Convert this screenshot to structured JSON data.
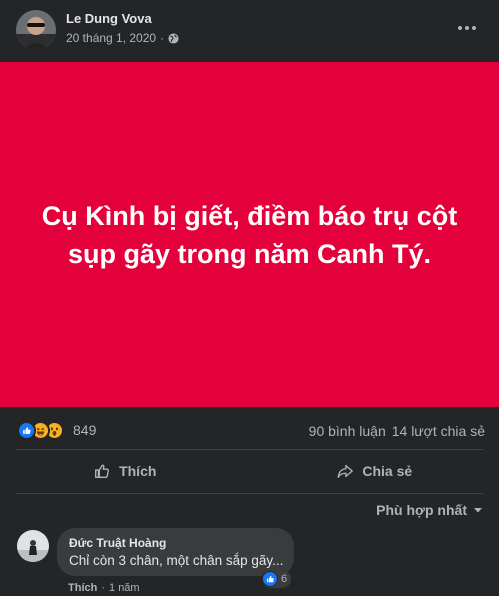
{
  "post": {
    "author_name": "Le Dung Vova",
    "date": "20 tháng 1, 2020",
    "separator": "·",
    "privacy_icon": "globe-icon",
    "more_icon": "more-horizontal-icon",
    "content_text": "Cụ Kình bị giết, điềm báo trụ cột sụp gãy trong năm Canh Tý.",
    "content_background": "#e3003b"
  },
  "stats": {
    "reaction_icons": [
      "like-icon",
      "haha-icon",
      "wow-icon"
    ],
    "reaction_count": "849",
    "comments": "90 bình luận",
    "shares": "14 lượt chia sẻ"
  },
  "actions": {
    "like_label": "Thích",
    "share_label": "Chia sẻ"
  },
  "sort": {
    "label": "Phù hợp nhất"
  },
  "comment": {
    "author": "Đức Truật Hoàng",
    "text": "Chỉ còn 3 chân, một chân sắp gãy...",
    "reaction_count": "6",
    "like_label": "Thích",
    "separator": "·",
    "time": "1 năm"
  },
  "colors": {
    "background": "#242526",
    "accent_red": "#e3003b",
    "like_blue": "#1877f2",
    "text_secondary": "#b0b3b8"
  }
}
